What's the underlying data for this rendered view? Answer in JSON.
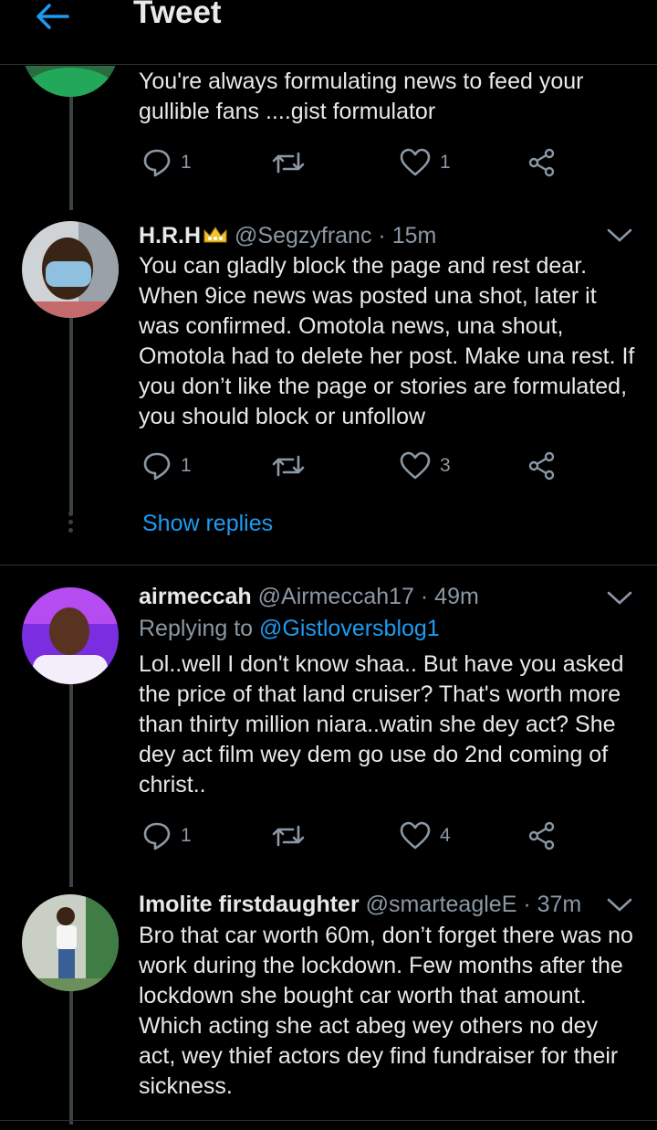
{
  "header": {
    "title": "Tweet"
  },
  "tweets": [
    {
      "text": "You're always formulating news to feed your gullible fans ....gist formulator",
      "replies": "1",
      "likes": "1"
    },
    {
      "name": "H.R.H",
      "handle": "@Segzyfranc",
      "time": "· 15m",
      "text": "You can gladly block the page and rest dear. When 9ice news was posted una shot, later it was confirmed. Omotola news, una shout, Omotola had to delete her post. Make una rest. If you don’t like the page or stories are formulated, you should block or unfollow",
      "replies": "1",
      "likes": "3",
      "show_replies": "Show replies"
    },
    {
      "name": "airmeccah",
      "handle": "@Airmeccah17",
      "time": "· 49m",
      "replying_label": "Replying to",
      "replying_handle": "@Gistloversblog1",
      "text": "Lol..well I don't know shaa.. But have you asked the price of that land cruiser? That's worth more than thirty million niara..watin she dey act? She dey act film wey dem go use do 2nd coming of christ..",
      "replies": "1",
      "likes": "4"
    },
    {
      "name": "Imolite firstdaughter",
      "handle": "@smarteagleE",
      "time": "· 37m",
      "text": "Bro that car worth 60m, don’t forget there was no work during the lockdown. Few months after the lockdown she bought car worth that amount. Which acting she act abeg wey others no dey act, wey thief actors dey find fundraiser for their sickness."
    }
  ],
  "colors": {
    "accent": "#1d9bf0",
    "muted": "#8b98a5",
    "text": "#e7e9ea",
    "background": "#000000"
  },
  "icons": [
    "back-arrow-icon",
    "crown-icon",
    "chevron-down-icon",
    "reply-icon",
    "retweet-icon",
    "like-icon",
    "share-icon"
  ]
}
